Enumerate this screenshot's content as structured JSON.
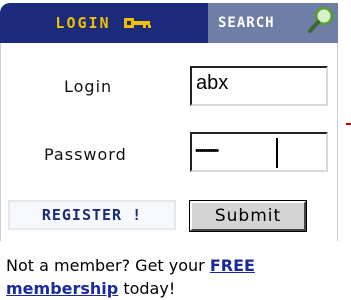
{
  "tabs": {
    "login_label": "LOGIN",
    "search_label": "SEARCH"
  },
  "form": {
    "login_label": "Login",
    "login_value": "abx",
    "password_label": "Password",
    "password_masked": "••••••••••••"
  },
  "buttons": {
    "register_label": "REGISTER !",
    "submit_label": "Submit"
  },
  "footer": {
    "prefix": "Not a member? Get your ",
    "link_text_1": "FREE",
    "link_text_2": "membership",
    "suffix": " today!"
  },
  "colors": {
    "login_tab_bg": "#1b2a7a",
    "login_tab_text": "#f0c000",
    "search_tab_bg": "#6f7ea6",
    "link": "#1b2a9a"
  },
  "icons": {
    "login_tab_icon": "key-icon",
    "search_tab_icon": "magnifier-icon"
  }
}
